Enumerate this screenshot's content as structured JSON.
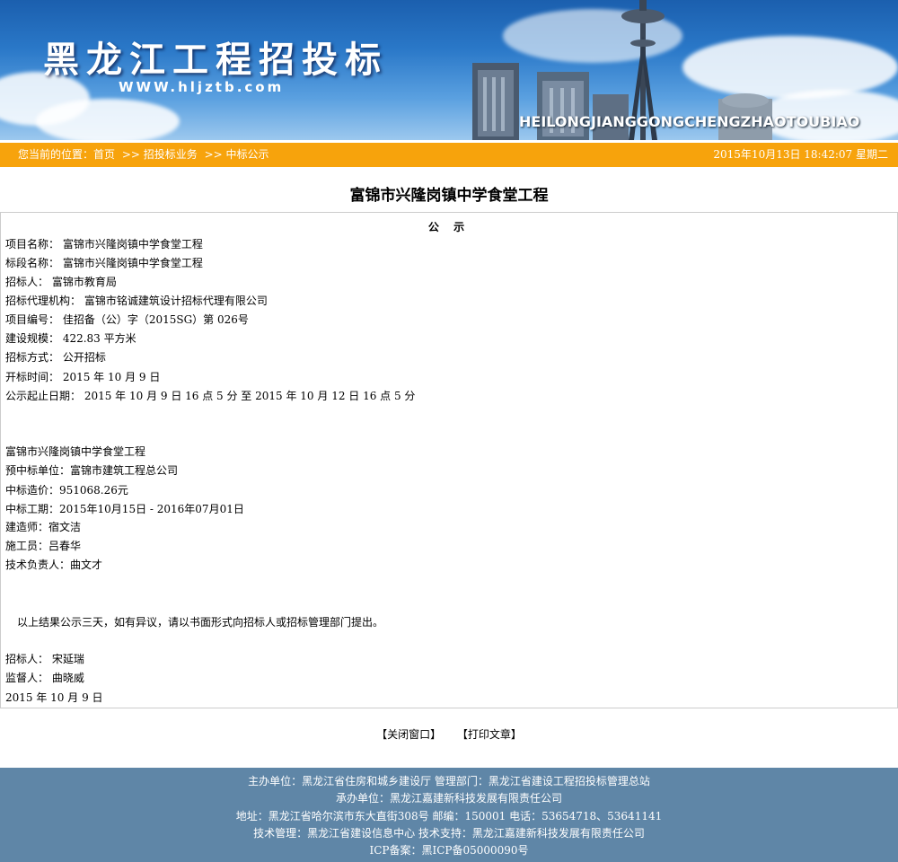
{
  "header": {
    "site_title": "黑龙江工程招投标",
    "site_url": "WWW.hljztb.com",
    "pinyin": "HEILONGJIANGGONGCHENGZHAOTOUBIAO"
  },
  "nav": {
    "breadcrumb_prefix": "您当前的位置：",
    "items": [
      "首页",
      ">> 招投标业务",
      ">> 中标公示"
    ],
    "datetime": "2015年10月13日  18:42:07 星期二"
  },
  "page": {
    "title": "富锦市兴隆岗镇中学食堂工程",
    "notice_heading": "公 示",
    "fields": [
      "项目名称：  富锦市兴隆岗镇中学食堂工程",
      "标段名称：  富锦市兴隆岗镇中学食堂工程",
      "招标人：  富锦市教育局",
      "招标代理机构：  富锦市铭诚建筑设计招标代理有限公司",
      "项目编号：  佳招备（公）字（2015SG）第  026号",
      "建设规模：   422.83 平方米",
      "招标方式：  公开招标",
      "开标时间：  2015 年  10 月  9 日",
      "公示起止日期：  2015 年  10 月  9 日  16 点  5 分  至  2015 年  10 月  12 日  16 点  5 分"
    ],
    "result": [
      "富锦市兴隆岗镇中学食堂工程",
      "预中标单位：富锦市建筑工程总公司",
      "中标造价：951068.26元",
      "中标工期：2015年10月15日  - 2016年07月01日",
      "建造师：宿文洁",
      "施工员：吕春华",
      "技术负责人：曲文才"
    ],
    "statement": "以上结果公示三天，如有异议，请以书面形式向招标人或招标管理部门提出。",
    "signatures": [
      "招标人：  宋延瑞",
      "监督人：  曲晓威",
      "2015 年  10 月  9 日"
    ]
  },
  "actions": {
    "close": "【关闭窗口】",
    "print": "【打印文章】"
  },
  "footer": {
    "lines": [
      "主办单位：黑龙江省住房和城乡建设厅  管理部门：黑龙江省建设工程招投标管理总站",
      "承办单位：黑龙江嘉建新科技发展有限责任公司",
      "地址：黑龙江省哈尔滨市东大直街308号  邮编：150001  电话：53654718、53641141",
      "技术管理：黑龙江省建设信息中心   技术支持：黑龙江嘉建新科技发展有限责任公司",
      "ICP备案：黑ICP备05000090号"
    ]
  },
  "colors": {
    "nav_bar": "#f7a30c",
    "footer_bg": "#5f86a7",
    "banner_sky": "#2a78c8"
  }
}
